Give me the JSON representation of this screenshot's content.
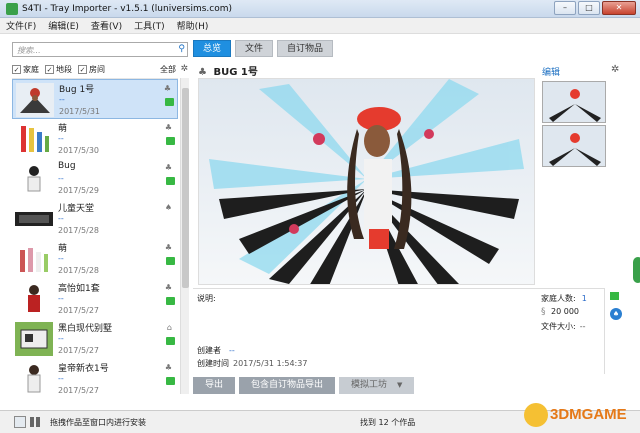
{
  "window": {
    "title": "S4TI - Tray Importer - v1.5.1 (luniversims.com)",
    "min": "–",
    "max": "□",
    "close": "✕"
  },
  "menu": [
    "文件(F)",
    "编辑(E)",
    "查看(V)",
    "工具(T)",
    "帮助(H)"
  ],
  "search": {
    "placeholder": "搜索..."
  },
  "filters": {
    "household": "家庭",
    "lot": "地段",
    "room": "房间",
    "all": "全部"
  },
  "tabs": [
    "总览",
    "文件",
    "自订物品"
  ],
  "selected_title": "BUG 1号",
  "edit_label": "编辑",
  "items": [
    {
      "name": "Bug 1号",
      "dash": "--",
      "date": "2017/5/31"
    },
    {
      "name": "萌",
      "dash": "--",
      "date": "2017/5/30"
    },
    {
      "name": "Bug",
      "dash": "--",
      "date": "2017/5/29"
    },
    {
      "name": "儿童天堂",
      "dash": "--",
      "date": "2017/5/28"
    },
    {
      "name": "萌",
      "dash": "--",
      "date": "2017/5/28"
    },
    {
      "name": "高怡如1套",
      "dash": "--",
      "date": "2017/5/27"
    },
    {
      "name": "黑白现代别墅",
      "dash": "--",
      "date": "2017/5/27"
    },
    {
      "name": "皇帝新衣1号",
      "dash": "--",
      "date": "2017/5/27"
    }
  ],
  "info": {
    "desc_label": "说明:",
    "creator_label": "创建者",
    "creator_value": "--",
    "created_label": "创建时间",
    "created_value": "2017/5/31 1:54:37",
    "household_size_label": "家庭人数:",
    "household_size": "1",
    "funds": "20 000",
    "filesize_label": "文件大小:",
    "filesize": "--"
  },
  "actions": {
    "export": "导出",
    "export_cc": "包含自订物品导出",
    "sim_studio": "模拟工坊"
  },
  "status": {
    "drag_hint": "拖拽作品至窗口内进行安装",
    "found": "找到 12 个作品"
  },
  "watermark": "3DMGAME",
  "colors": {
    "accent": "#1f8fe0",
    "tag_green": "#37b843"
  }
}
